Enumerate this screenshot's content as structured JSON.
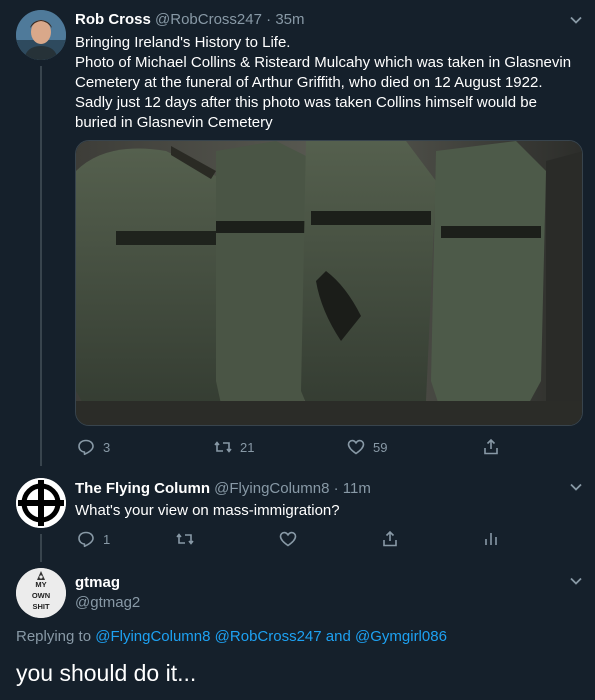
{
  "tweet1": {
    "name": "Rob Cross",
    "handle": "@RobCross247",
    "time": "35m",
    "line1": "Bringing Ireland's History to Life.",
    "line2": "Photo of Michael Collins & Risteard Mulcahy which was taken in Glasnevin Cemetery at the funeral of Arthur Griffith, who died on 12 August 1922. Sadly just 12 days after this photo was taken Collins himself would be buried in Glasnevin Cemetery",
    "replies": "3",
    "retweets": "21",
    "likes": "59"
  },
  "tweet2": {
    "name": "The Flying Column",
    "handle": "@FlyingColumn8",
    "time": "11m",
    "text": "What's your view on mass-immigration?",
    "replies": "1"
  },
  "tweet3": {
    "name": "gtmag",
    "handle": "@gtmag2",
    "avatar_lines": [
      "MY",
      "OWN",
      "SHIT"
    ],
    "replying_prefix": "Replying to",
    "reply_to": [
      "@FlyingColumn8",
      "@RobCross247"
    ],
    "reply_and": "and",
    "reply_last": "@Gymgirl086",
    "text": "you should do it..."
  },
  "colors": {
    "background": "#15202b",
    "muted": "#8899a6",
    "accent": "#1da1f2",
    "border": "#38444d"
  },
  "icons": [
    "chevron-down-icon",
    "reply-icon",
    "retweet-icon",
    "like-icon",
    "share-icon",
    "analytics-icon"
  ]
}
